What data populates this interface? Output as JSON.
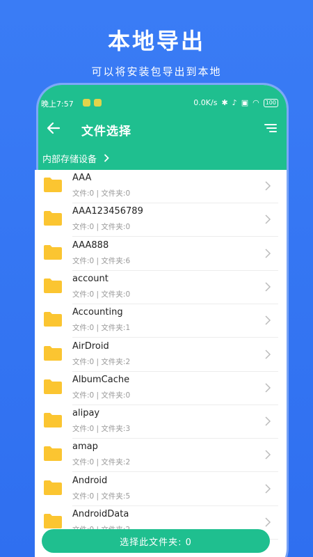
{
  "promo": {
    "title": "本地导出",
    "subtitle": "可以将安装包导出到本地"
  },
  "statusbar": {
    "time": "晚上7:57",
    "speed": "0.0K/s",
    "battery": "100"
  },
  "toolbar": {
    "title": "文件选择"
  },
  "breadcrumb": {
    "label": "内部存储设备"
  },
  "files": [
    {
      "name": "AAA",
      "meta": "文件:0 | 文件夹:0"
    },
    {
      "name": "AAA123456789",
      "meta": "文件:0 | 文件夹:0"
    },
    {
      "name": "AAA888",
      "meta": "文件:0 | 文件夹:6"
    },
    {
      "name": "account",
      "meta": "文件:0 | 文件夹:0"
    },
    {
      "name": "Accounting",
      "meta": "文件:0 | 文件夹:1"
    },
    {
      "name": "AirDroid",
      "meta": "文件:0 | 文件夹:2"
    },
    {
      "name": "AlbumCache",
      "meta": "文件:0 | 文件夹:0"
    },
    {
      "name": "alipay",
      "meta": "文件:0 | 文件夹:3"
    },
    {
      "name": "amap",
      "meta": "文件:0 | 文件夹:2"
    },
    {
      "name": "Android",
      "meta": "文件:0 | 文件夹:5"
    },
    {
      "name": "AndroidData",
      "meta": "文件:0 | 文件夹:2"
    }
  ],
  "select_button": {
    "label": "选择此文件夹: 0"
  },
  "colors": {
    "accent": "#1fbf8f",
    "background": "#2f6ff0",
    "folder": "#fbc531"
  },
  "icons": {
    "back": "arrow-left-icon",
    "sort": "sort-icon",
    "folder": "folder-icon",
    "chevron": "chevron-right-icon"
  }
}
